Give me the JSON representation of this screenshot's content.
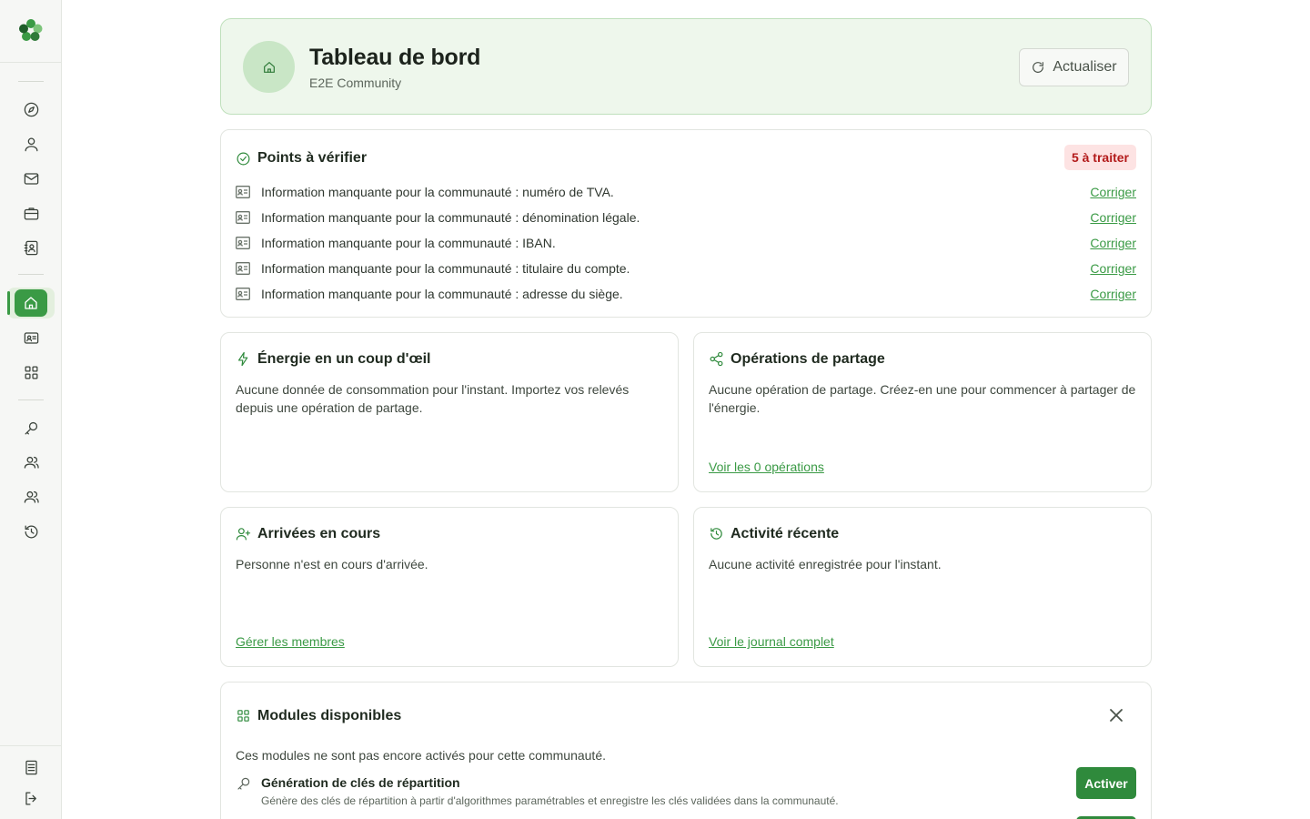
{
  "header": {
    "title": "Tableau de bord",
    "subtitle": "E2E Community",
    "refresh_label": "Actualiser"
  },
  "checks": {
    "title": "Points à vérifier",
    "badge": "5 à traiter",
    "fix_label": "Corriger",
    "items": [
      {
        "text": "Information manquante pour la communauté : numéro de TVA."
      },
      {
        "text": "Information manquante pour la communauté : dénomination légale."
      },
      {
        "text": "Information manquante pour la communauté : IBAN."
      },
      {
        "text": "Information manquante pour la communauté : titulaire du compte."
      },
      {
        "text": "Information manquante pour la communauté : adresse du siège."
      }
    ]
  },
  "energy": {
    "title": "Énergie en un coup d'œil",
    "text": "Aucune donnée de consommation pour l'instant. Importez vos relevés depuis une opération de partage."
  },
  "operations": {
    "title": "Opérations de partage",
    "text": "Aucune opération de partage. Créez-en une pour commencer à partager de l'énergie.",
    "link": "Voir les 0 opérations"
  },
  "arrivals": {
    "title": "Arrivées en cours",
    "text": "Personne n'est en cours d'arrivée.",
    "link": "Gérer les membres"
  },
  "activity": {
    "title": "Activité récente",
    "text": "Aucune activité enregistrée pour l'instant.",
    "link": "Voir le journal complet"
  },
  "modules": {
    "title": "Modules disponibles",
    "intro": "Ces modules ne sont pas encore activés pour cette communauté.",
    "items": [
      {
        "name": "Génération de clés de répartition",
        "description": "Génère des clés de répartition à partir d'algorithmes paramétrables et enregistre les clés validées dans la communauté.",
        "button": "Activer",
        "icon": "key-icon"
      }
    ]
  },
  "colors": {
    "accent": "#3a9a45",
    "header_bg": "#eef7ec",
    "badge_bg": "#fde3e3",
    "badge_text": "#b31b1b"
  }
}
